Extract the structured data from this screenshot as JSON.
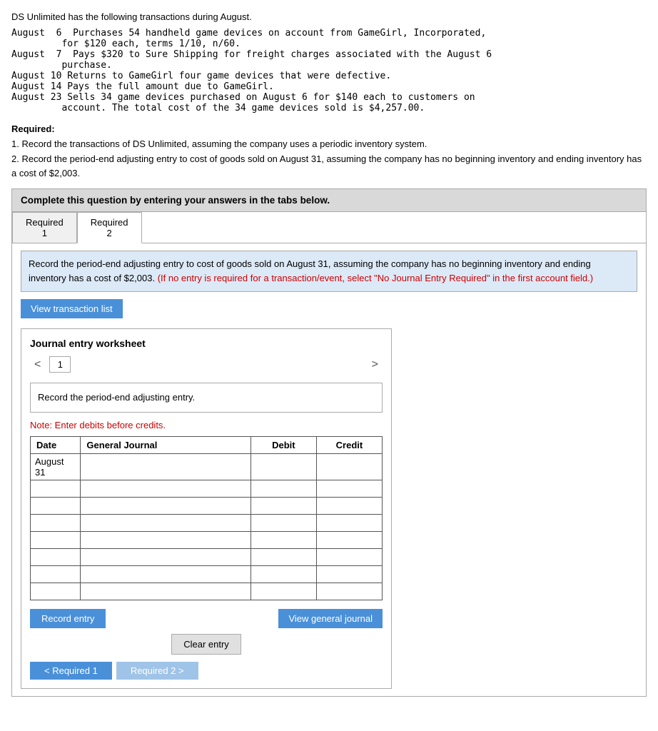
{
  "intro": {
    "line1": "DS Unlimited has the following transactions during August.",
    "transactions": "August  6  Purchases 54 handheld game devices on account from GameGirl, Incorporated,\n         for $120 each, terms 1/10, n/60.\nAugust  7  Pays $320 to Sure Shipping for freight charges associated with the August 6\n         purchase.\nAugust 10 Returns to GameGirl four game devices that were defective.\nAugust 14 Pays the full amount due to GameGirl.\nAugust 23 Sells 34 game devices purchased on August 6 for $140 each to customers on\n         account. The total cost of the 34 game devices sold is $4,257.00."
  },
  "required": {
    "heading": "Required:",
    "point1": "1. Record the transactions of DS Unlimited, assuming the company uses a periodic inventory system.",
    "point2": "2. Record the period-end adjusting entry to cost of goods sold on August 31, assuming the company has no beginning inventory and ending inventory has a cost of $2,003."
  },
  "complete_box": {
    "text": "Complete this question by entering your answers in the tabs below."
  },
  "tabs": [
    {
      "label": "Required",
      "sub": "1"
    },
    {
      "label": "Required",
      "sub": "2"
    }
  ],
  "active_tab": 1,
  "instruction": {
    "main": "Record the period-end adjusting entry to cost of goods sold on August 31, assuming the company has no beginning inventory and ending inventory has a cost of $2,003.",
    "red": " (If no entry is required for a transaction/event, select \"No Journal Entry Required\" in the first account field.)"
  },
  "view_transaction_list": "View transaction list",
  "journal_worksheet": {
    "title": "Journal entry worksheet",
    "page": "1",
    "period_end_text": "Record the period-end adjusting entry.",
    "note": "Note: Enter debits before credits.",
    "table": {
      "headers": [
        "Date",
        "General Journal",
        "Debit",
        "Credit"
      ],
      "rows": [
        {
          "date": "August\n31",
          "general_journal": "",
          "debit": "",
          "credit": ""
        },
        {
          "date": "",
          "general_journal": "",
          "debit": "",
          "credit": ""
        },
        {
          "date": "",
          "general_journal": "",
          "debit": "",
          "credit": ""
        },
        {
          "date": "",
          "general_journal": "",
          "debit": "",
          "credit": ""
        },
        {
          "date": "",
          "general_journal": "",
          "debit": "",
          "credit": ""
        },
        {
          "date": "",
          "general_journal": "",
          "debit": "",
          "credit": ""
        },
        {
          "date": "",
          "general_journal": "",
          "debit": "",
          "credit": ""
        },
        {
          "date": "",
          "general_journal": "",
          "debit": "",
          "credit": ""
        }
      ]
    },
    "record_entry_btn": "Record entry",
    "clear_entry_btn": "Clear entry",
    "view_general_journal_btn": "View general journal"
  },
  "bottom_tabs": [
    {
      "label": "< Required 1",
      "active": true
    },
    {
      "label": "Required 2 >",
      "active": false
    }
  ]
}
